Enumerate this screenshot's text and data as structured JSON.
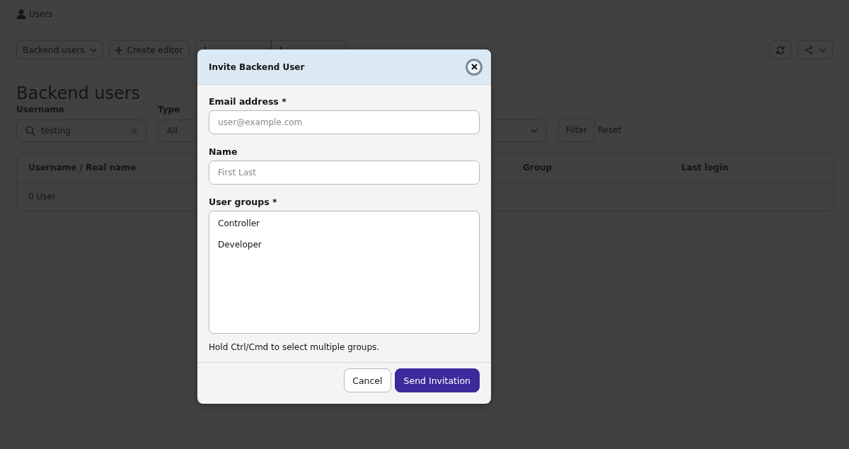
{
  "breadcrumb": {
    "title": "Users"
  },
  "toolbar": {
    "buttons": [
      {
        "label": "Backend users",
        "kind": "dropdown"
      },
      {
        "label": "Create editor",
        "kind": "add"
      },
      {
        "kind": "add"
      },
      {
        "kind": "add"
      }
    ],
    "actions": [
      {
        "kind": "refresh"
      },
      {
        "kind": "share"
      }
    ]
  },
  "heading": "Backend users",
  "filters": [
    {
      "label": "Username",
      "kind": "search",
      "value": "testing"
    },
    {
      "label": "Type",
      "kind": "select",
      "value": "All"
    },
    {
      "kind": "select"
    }
  ],
  "filter_button": "Filter",
  "reset_link": "Reset",
  "table": {
    "columns": [
      "Username / Real name",
      "Group",
      "Last login"
    ],
    "rows": [
      [
        "0 User"
      ]
    ]
  },
  "dialog": {
    "title": "Invite Backend User",
    "fields": [
      {
        "label": "Email address *",
        "kind": "text",
        "placeholder": "user@example.com"
      },
      {
        "label": "Name",
        "kind": "text",
        "placeholder": "First Last"
      },
      {
        "label": "User groups *",
        "kind": "listbox",
        "options": [
          {
            "label": "Controller",
            "selected": false
          },
          {
            "label": "Developer",
            "selected": false
          }
        ],
        "help": "Hold Ctrl/Cmd to select multiple groups."
      }
    ],
    "buttons": [
      {
        "label": "Cancel",
        "kind": "secondary"
      },
      {
        "label": "Send Invitation",
        "kind": "primary"
      }
    ]
  }
}
